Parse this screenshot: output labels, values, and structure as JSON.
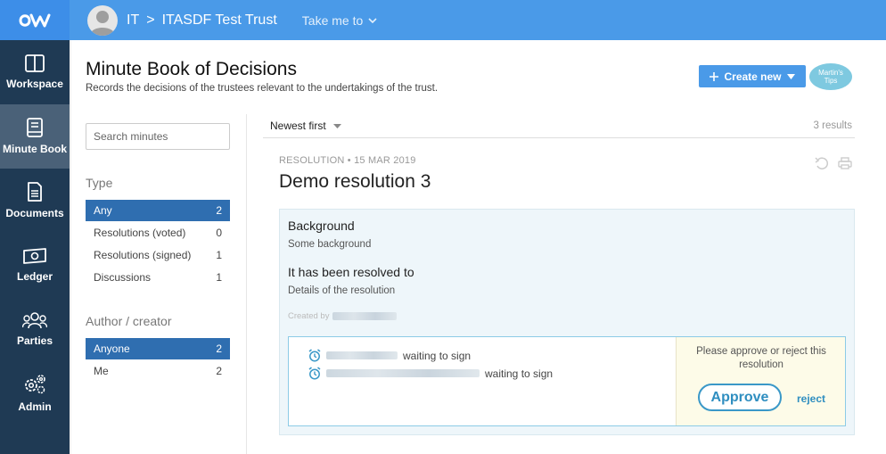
{
  "header": {
    "breadcrumb_org": "IT",
    "breadcrumb_sep": ">",
    "breadcrumb_trust": "ITASDF Test Trust",
    "take_me_to": "Take me to"
  },
  "sidebar": {
    "items": [
      {
        "label": "Workspace",
        "icon": "workspace-icon"
      },
      {
        "label": "Minute Book",
        "icon": "book-icon",
        "active": true
      },
      {
        "label": "Documents",
        "icon": "document-icon"
      },
      {
        "label": "Ledger",
        "icon": "ledger-icon"
      },
      {
        "label": "Parties",
        "icon": "parties-icon"
      },
      {
        "label": "Admin",
        "icon": "gear-icon"
      }
    ]
  },
  "page": {
    "title": "Minute Book of Decisions",
    "subtitle": "Records the decisions of the trustees relevant to the undertakings of the trust.",
    "create_new_label": "Create new",
    "tips_label_line1": "Martin's",
    "tips_label_line2": "Tips"
  },
  "filters": {
    "search_placeholder": "Search minutes",
    "type_heading": "Type",
    "type_options": [
      {
        "label": "Any",
        "count": "2",
        "selected": true
      },
      {
        "label": "Resolutions (voted)",
        "count": "0"
      },
      {
        "label": "Resolutions (signed)",
        "count": "1"
      },
      {
        "label": "Discussions",
        "count": "1"
      }
    ],
    "author_heading": "Author / creator",
    "author_options": [
      {
        "label": "Anyone",
        "count": "2",
        "selected": true
      },
      {
        "label": "Me",
        "count": "2"
      }
    ]
  },
  "list": {
    "sort_label": "Newest first",
    "results_label": "3 results"
  },
  "resolution": {
    "kind": "RESOLUTION",
    "date": "• 15 MAR 2019",
    "title": "Demo resolution 3",
    "background_heading": "Background",
    "background_body": "Some background",
    "resolved_heading": "It has been resolved to",
    "resolved_body": "Details of the resolution",
    "created_by_label": "Created by",
    "signers": [
      {
        "status": "waiting to sign"
      },
      {
        "status": "waiting to sign"
      }
    ],
    "approve_message": "Please approve or reject this resolution",
    "approve_label": "Approve",
    "reject_label": "reject"
  },
  "colors": {
    "topbar": "#4a9ae8",
    "sidebar": "#1f3a54",
    "selected_filter": "#2f6eb0",
    "accent": "#2f8ec0"
  }
}
